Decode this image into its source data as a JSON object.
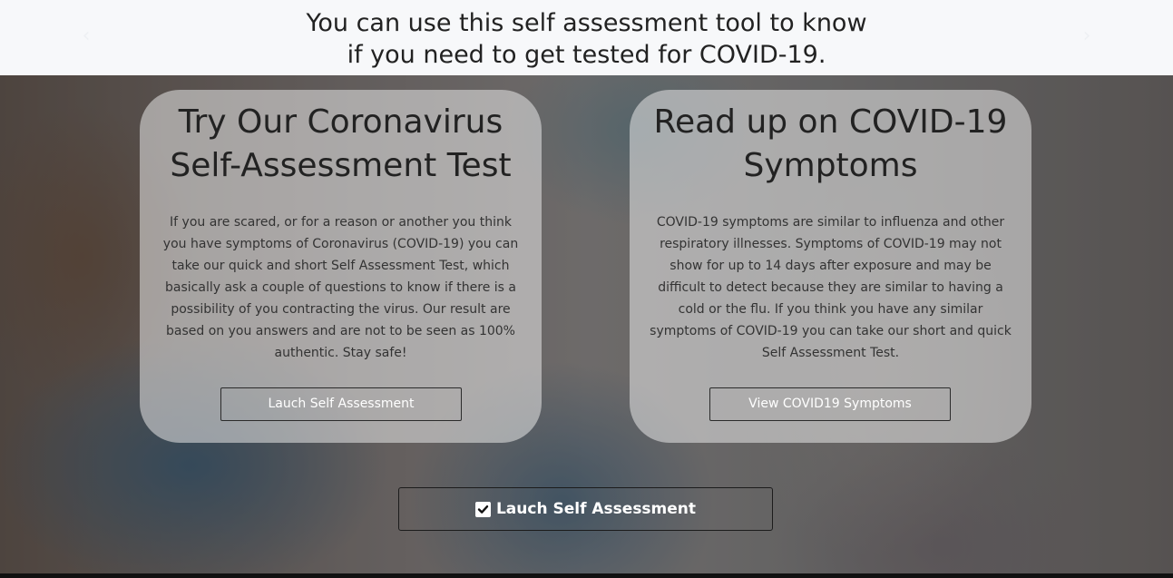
{
  "header": {
    "title_line1": "You can use this self assessment tool to know",
    "title_line2": "if you need to get tested for COVID-19.",
    "prev_arrow": "‹",
    "next_arrow": "›",
    "prev_icon": "chevron-left-icon",
    "next_icon": "chevron-right-icon"
  },
  "cards": [
    {
      "title_line1": "Try Our Coronavirus",
      "title_line2": "Self-Assessment Test",
      "text": "If you are scared, or for a reason or another you think you have symptoms of Coronavirus (COVID-19) you can take our quick and short Self Assessment Test, which basically ask a couple of questions to know if there is a possibility of you contracting the virus. Our result are based on you answers and are not to be seen as 100% authentic. Stay safe!",
      "button_label": "Lauch Self Assessment"
    },
    {
      "title_line1": "Read up on COVID-19",
      "title_line2": "Symptoms",
      "text": "COVID-19 symptoms are similar to influenza and other respiratory illnesses. Symptoms of COVID-19 may not show for up to 14 days after exposure and may be difficult to detect because they are similar to having a cold or the flu. If you think you have any similar symptoms of COVID-19 you can take our short and quick Self Assessment Test.",
      "button_label": "View COVID19 Symptoms"
    }
  ],
  "main_cta": {
    "label": "Lauch Self Assessment",
    "icon": "check-square-icon"
  },
  "colors": {
    "header_bg": "#f7f8fa",
    "card_bg": "rgba(232,232,232,0.55)",
    "text_dark": "#222222",
    "button_text": "#ffffff"
  }
}
